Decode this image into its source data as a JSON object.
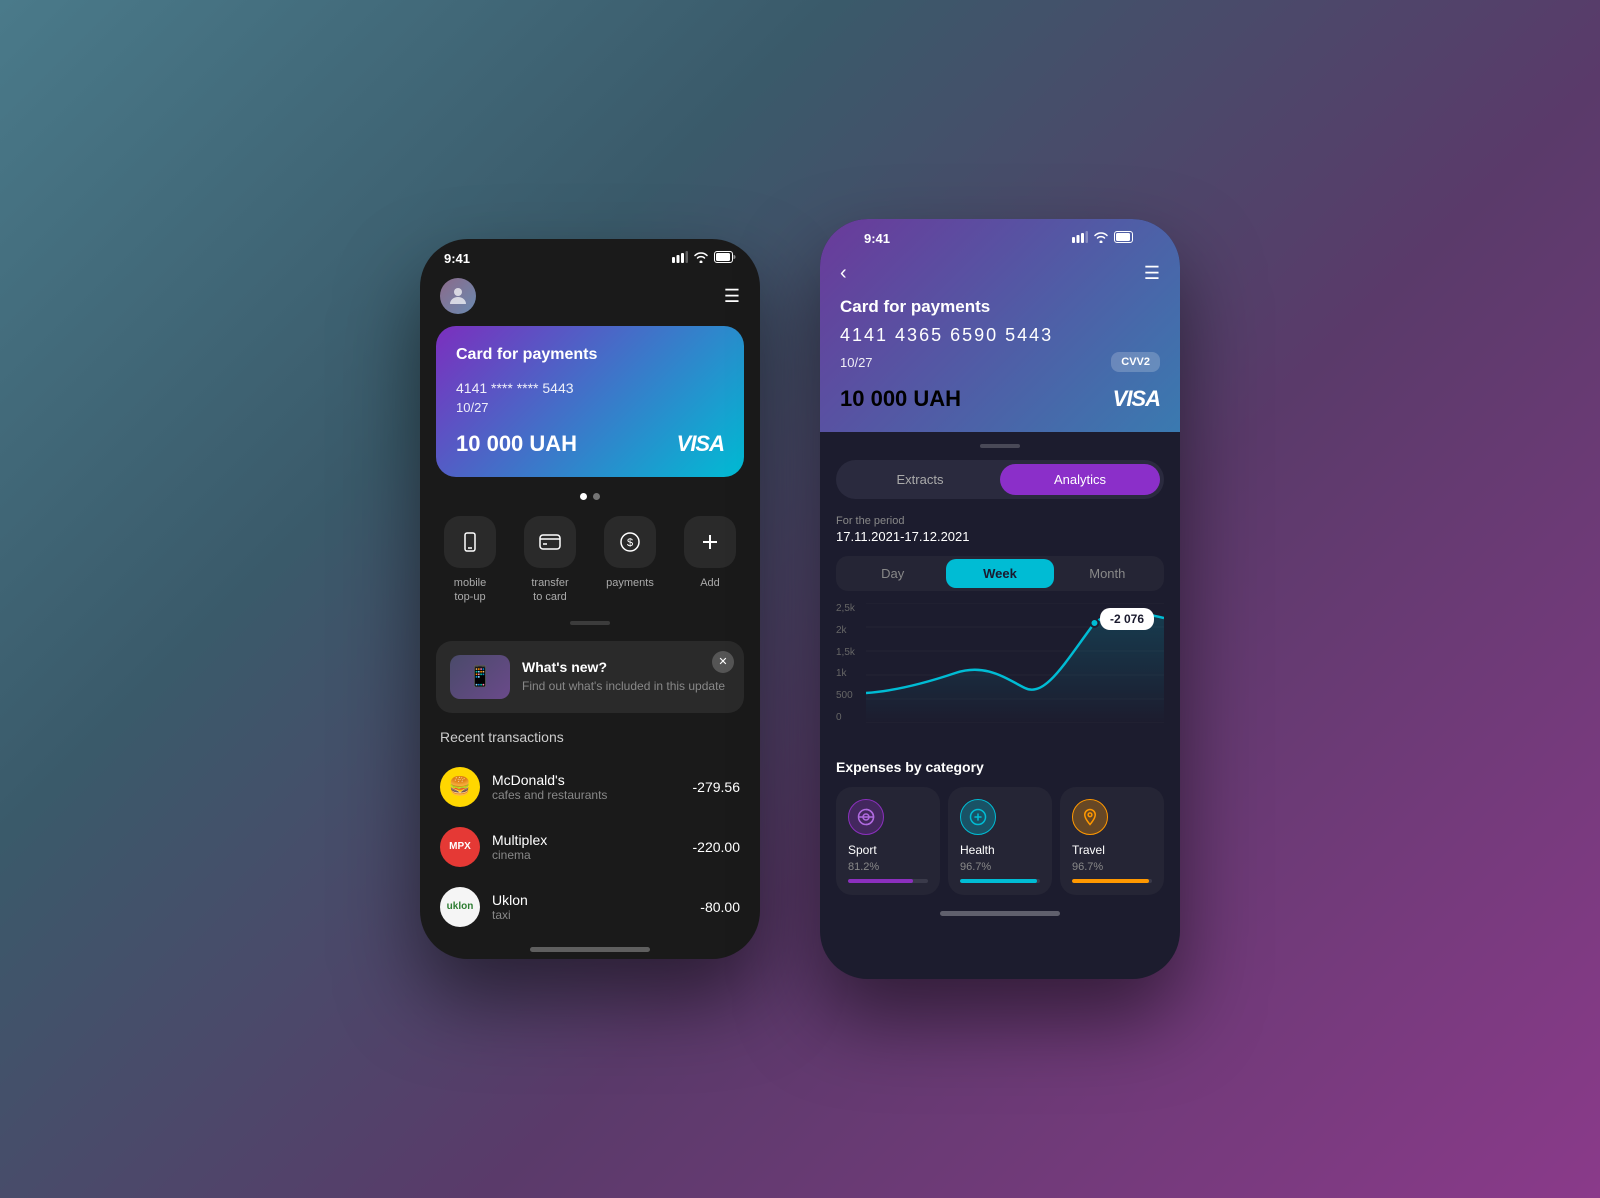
{
  "phone1": {
    "status_bar": {
      "time": "9:41",
      "signal": "▌▌▌",
      "wifi": "WiFi",
      "battery": "🔋"
    },
    "header": {
      "menu_icon": "☰"
    },
    "card": {
      "title": "Card for payments",
      "number": "4141  ****  ****  5443",
      "expiry": "10/27",
      "balance": "10 000 UAH",
      "brand": "VISA"
    },
    "actions": [
      {
        "icon": "📱",
        "label": "mobile\ntop-up"
      },
      {
        "icon": "💳",
        "label": "transfer\nto card"
      },
      {
        "icon": "$",
        "label": "payments"
      },
      {
        "icon": "+",
        "label": "Add"
      }
    ],
    "whats_new": {
      "title": "What's new?",
      "subtitle": "Find out what's included\nin this update"
    },
    "recent_section": "Recent transactions",
    "transactions": [
      {
        "name": "McDonald's",
        "category": "cafes and restaurants",
        "amount": "-279.56",
        "icon": "M"
      },
      {
        "name": "Multiplex",
        "category": "cinema",
        "amount": "-220.00",
        "icon": "M"
      },
      {
        "name": "Uklon",
        "category": "taxi",
        "amount": "-80.00",
        "icon": "U"
      }
    ]
  },
  "phone2": {
    "status_bar": {
      "time": "9:41"
    },
    "card": {
      "title": "Card for payments",
      "number_full": "4141  4365  6590  5443",
      "expiry": "10/27",
      "cvv_label": "CVV2",
      "balance": "10 000 UAH",
      "brand": "VISA"
    },
    "tabs": {
      "extracts": "Extracts",
      "analytics": "Analytics"
    },
    "period": {
      "label": "For the period",
      "date": "17.11.2021-17.12.2021"
    },
    "time_tabs": [
      "Day",
      "Week",
      "Month"
    ],
    "chart": {
      "tooltip": "-2 076",
      "y_labels": [
        "2,5k",
        "2k",
        "1,5k",
        "1k",
        "500",
        "0"
      ]
    },
    "expenses_title": "Expenses by category",
    "expense_cards": [
      {
        "name": "Sport",
        "pct": "81.2%",
        "icon_type": "sport"
      },
      {
        "name": "Health",
        "pct": "96.7%",
        "icon_type": "health"
      },
      {
        "name": "Travel",
        "pct": "96.7%",
        "icon_type": "travel"
      }
    ]
  }
}
